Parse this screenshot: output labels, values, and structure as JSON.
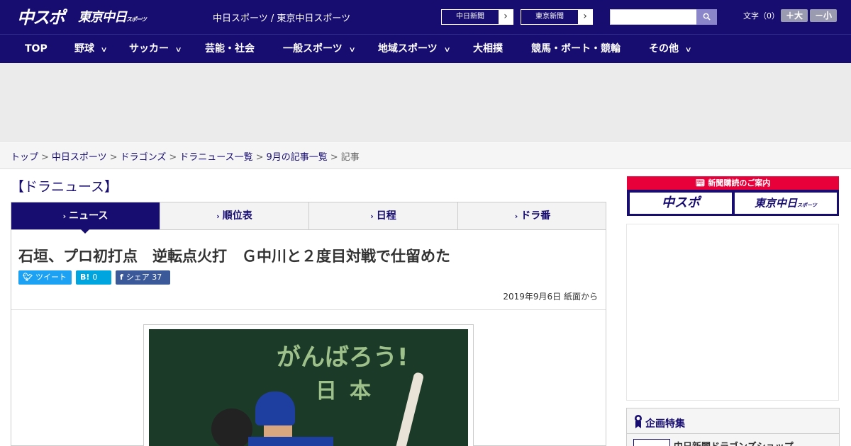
{
  "header": {
    "logo_main": "中スポ",
    "logo_tokyo": "東京中日",
    "logo_tokyo_small": "スポーツ",
    "site_title": "中日スポーツ / 東京中日スポーツ",
    "paper_links": [
      {
        "label": "中日新聞"
      },
      {
        "label": "東京新聞"
      }
    ],
    "search": {
      "placeholder": ""
    },
    "fontsize": {
      "label": "文字（0）",
      "large": "＋大",
      "small": "－小"
    }
  },
  "nav": {
    "items": [
      {
        "label": "TOP"
      },
      {
        "label": "野球"
      },
      {
        "label": "サッカー"
      },
      {
        "label": "芸能・社会"
      },
      {
        "label": "一般スポーツ"
      },
      {
        "label": "地域スポーツ"
      },
      {
        "label": "大相撲"
      },
      {
        "label": "競馬・ボート・競輪"
      },
      {
        "label": "その他"
      }
    ]
  },
  "breadcrumb": {
    "items": [
      {
        "label": "トップ"
      },
      {
        "label": "中日スポーツ"
      },
      {
        "label": "ドラゴンズ"
      },
      {
        "label": "ドラニュース一覧"
      },
      {
        "label": "9月の記事一覧"
      }
    ],
    "current": "記事",
    "separator": ">"
  },
  "main": {
    "section_title": "【ドラニュース】",
    "tabs": [
      {
        "label": "ニュース",
        "active": true
      },
      {
        "label": "順位表"
      },
      {
        "label": "日程"
      },
      {
        "label": "ドラ番"
      }
    ],
    "article": {
      "headline": "石垣、プロ初打点　逆転点火打　Ｇ中川と２度目対戦で仕留めた",
      "share": {
        "tweet": "ツイート",
        "hatena_icon": "B!",
        "hatena_count": "0",
        "fb_label": "シェア",
        "fb_count": "37"
      },
      "date": "2019年9月6日 紙面から",
      "photo_text_1": "がんばろう!",
      "photo_text_2": "日本"
    }
  },
  "sidebar": {
    "banner_title": "新聞購読のご案内",
    "banner_logo_main": "中スポ",
    "banner_logo_tokyo": "東京中日",
    "banner_logo_tokyo_small": "スポーツ",
    "feature_title": "企画特集",
    "feature_item": "中日新聞ドラゴンズショップ"
  },
  "colors": {
    "brand": "#170d70",
    "accent_red": "#e8003a",
    "twitter": "#1da1f2",
    "hatena": "#00a4de",
    "facebook": "#3b5998"
  }
}
